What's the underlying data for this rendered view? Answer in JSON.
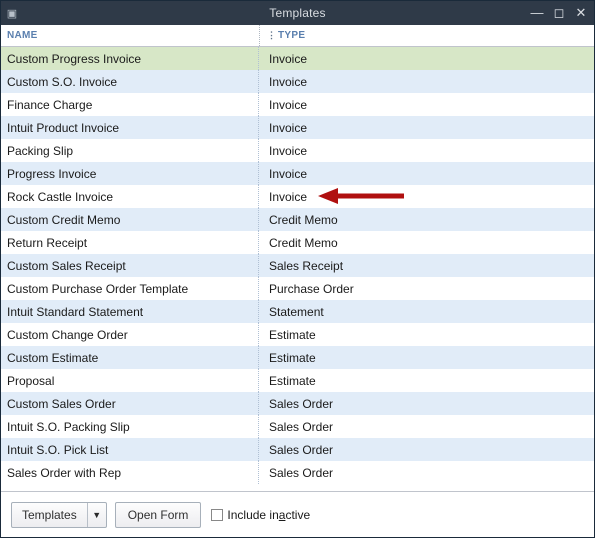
{
  "window": {
    "title": "Templates"
  },
  "columns": {
    "name": "NAME",
    "type": "TYPE"
  },
  "rows": [
    {
      "name": "Custom Progress Invoice",
      "type": "Invoice",
      "selected": true
    },
    {
      "name": "Custom S.O. Invoice",
      "type": "Invoice"
    },
    {
      "name": "Finance Charge",
      "type": "Invoice"
    },
    {
      "name": "Intuit Product Invoice",
      "type": "Invoice"
    },
    {
      "name": "Packing Slip",
      "type": "Invoice"
    },
    {
      "name": "Progress Invoice",
      "type": "Invoice"
    },
    {
      "name": "Rock Castle Invoice",
      "type": "Invoice",
      "arrow": true
    },
    {
      "name": "Custom Credit Memo",
      "type": "Credit Memo"
    },
    {
      "name": "Return Receipt",
      "type": "Credit Memo"
    },
    {
      "name": "Custom Sales Receipt",
      "type": "Sales Receipt"
    },
    {
      "name": "Custom Purchase Order Template",
      "type": "Purchase Order"
    },
    {
      "name": "Intuit Standard Statement",
      "type": "Statement"
    },
    {
      "name": "Custom Change Order",
      "type": "Estimate"
    },
    {
      "name": "Custom Estimate",
      "type": "Estimate"
    },
    {
      "name": "Proposal",
      "type": "Estimate"
    },
    {
      "name": "Custom Sales Order",
      "type": "Sales Order"
    },
    {
      "name": "Intuit S.O. Packing Slip",
      "type": "Sales Order"
    },
    {
      "name": "Intuit S.O. Pick List",
      "type": "Sales Order"
    },
    {
      "name": "Sales Order with Rep",
      "type": "Sales Order"
    }
  ],
  "footer": {
    "templates_btn": "Templates",
    "open_form_btn": "Open Form",
    "include_inactive_label": "Include inactive",
    "include_inactive_checked": false
  },
  "arrow_color": "#b01010"
}
